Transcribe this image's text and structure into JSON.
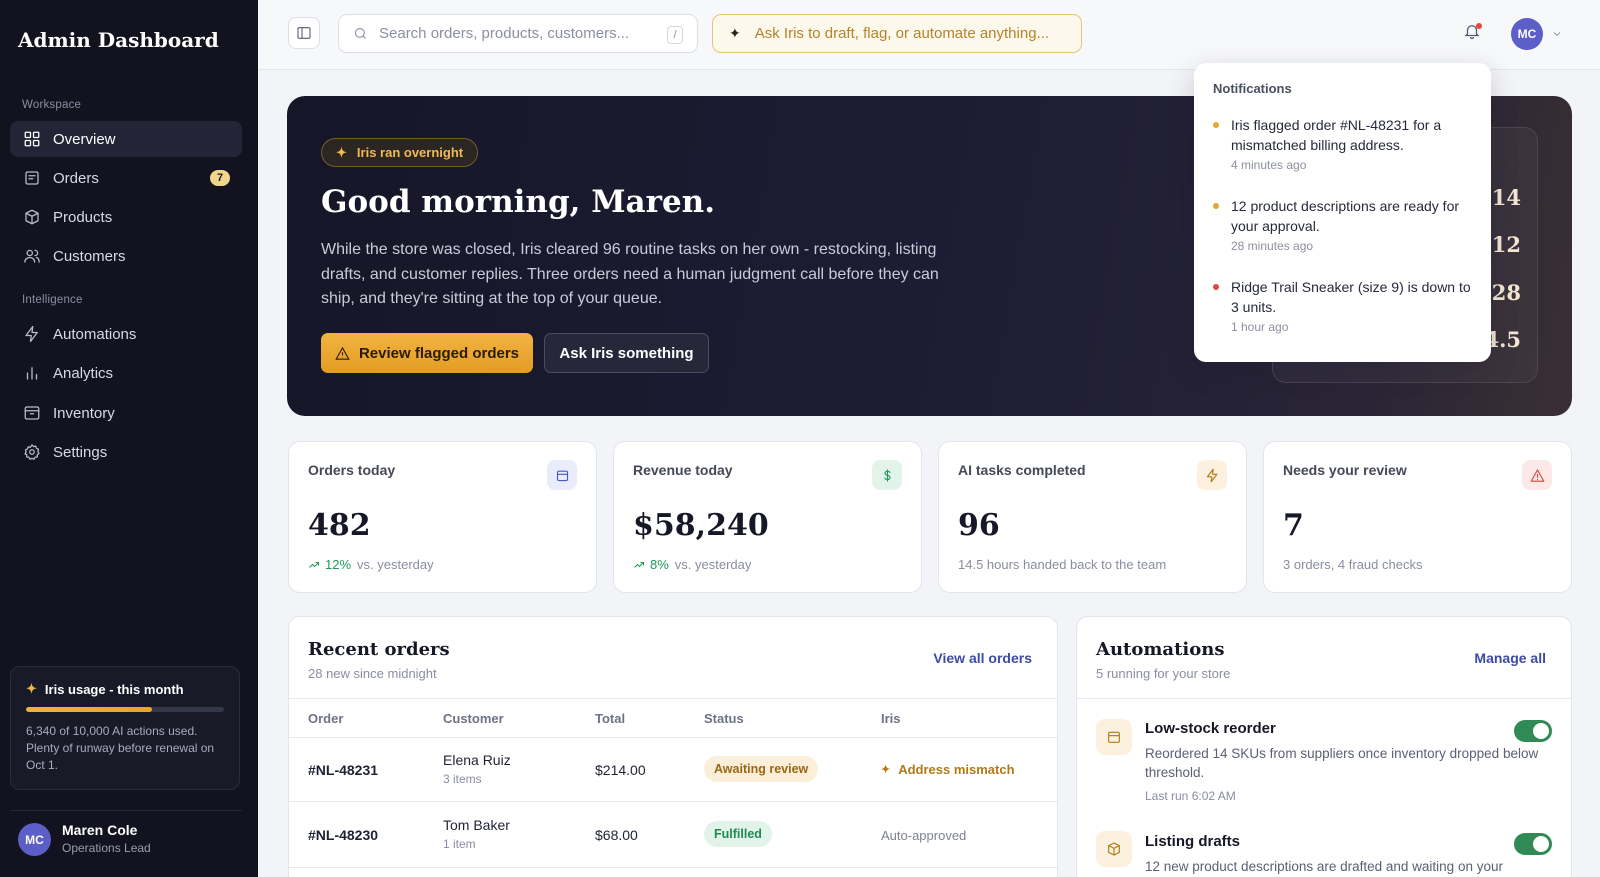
{
  "sidebar": {
    "brand": "Admin Dashboard",
    "sections": {
      "workspace": "Workspace",
      "intelligence": "Intelligence"
    },
    "items": [
      {
        "label": "Overview",
        "icon": "grid-icon",
        "active": true
      },
      {
        "label": "Orders",
        "icon": "orders-icon",
        "badge": "7"
      },
      {
        "label": "Products",
        "icon": "box-icon"
      },
      {
        "label": "Customers",
        "icon": "users-icon"
      },
      {
        "label": "Automations",
        "icon": "bolt-icon"
      },
      {
        "label": "Analytics",
        "icon": "bar-chart-icon"
      },
      {
        "label": "Inventory",
        "icon": "archive-icon"
      },
      {
        "label": "Settings",
        "icon": "gear-icon"
      }
    ],
    "usage": {
      "title": "Iris usage - this month",
      "used_fraction": 0.634,
      "text": "6,340 of 10,000 AI actions used. Plenty of runway before renewal on Oct 1."
    },
    "user": {
      "initials": "MC",
      "name": "Maren Cole",
      "role": "Operations Lead"
    }
  },
  "topbar": {
    "search_placeholder": "Search orders, products, customers...",
    "search_shortcut": "/",
    "ask_placeholder": "Ask Iris to draft, flag, or automate anything...",
    "avatar_initials": "MC"
  },
  "hero": {
    "pill": "Iris ran overnight",
    "title": "Good morning, Maren.",
    "body": "While the store was closed, Iris cleared 96 routine tasks on her own - restocking, listing drafts, and customer replies. Three orders need a human judgment call before they can ship, and they're sitting at the top of your queue.",
    "primary_button": "Review flagged orders",
    "secondary_button": "Ask Iris something",
    "panel_values": [
      "14",
      "12",
      "28",
      "4.5"
    ]
  },
  "notifications": {
    "title": "Notifications",
    "items": [
      {
        "text": "Iris flagged order #NL-48231 for a mismatched billing address.",
        "time": "4 minutes ago",
        "color": "#e8a52d"
      },
      {
        "text": "12 product descriptions are ready for your approval.",
        "time": "28 minutes ago",
        "color": "#e8a52d"
      },
      {
        "text": "Ridge Trail Sneaker (size 9) is down to 3 units.",
        "time": "1 hour ago",
        "color": "#e0473d"
      }
    ]
  },
  "stats": [
    {
      "label": "Orders today",
      "value": "482",
      "trend": "12%",
      "sub": "vs. yesterday",
      "icon": "calendar-icon"
    },
    {
      "label": "Revenue today",
      "value": "$58,240",
      "trend": "8%",
      "sub": "vs. yesterday",
      "icon": "dollar-icon"
    },
    {
      "label": "AI tasks completed",
      "value": "96",
      "sub": "14.5 hours handed back to the team",
      "icon": "bolt-icon"
    },
    {
      "label": "Needs your review",
      "value": "7",
      "sub": "3 orders, 4 fraud checks",
      "icon": "alert-icon"
    }
  ],
  "orders": {
    "title": "Recent orders",
    "subtitle": "28 new since midnight",
    "link": "View all orders",
    "columns": [
      "Order",
      "Customer",
      "Total",
      "Status",
      "Iris"
    ],
    "rows": [
      {
        "id": "#NL-48231",
        "customer": "Elena Ruiz",
        "items": "3 items",
        "total": "$214.00",
        "status": "Awaiting review",
        "iris": "Address mismatch"
      },
      {
        "id": "#NL-48230",
        "customer": "Tom Baker",
        "items": "1 item",
        "total": "$68.00",
        "status": "Fulfilled",
        "iris": "Auto-approved"
      }
    ]
  },
  "automations": {
    "title": "Automations",
    "subtitle": "5 running for your store",
    "link": "Manage all",
    "items": [
      {
        "name": "Low-stock reorder",
        "desc": "Reordered 14 SKUs from suppliers once inventory dropped below threshold.",
        "time": "Last run 6:02 AM",
        "enabled": true
      },
      {
        "name": "Listing drafts",
        "desc": "12 new product descriptions are drafted and waiting on your",
        "enabled": true
      }
    ]
  }
}
